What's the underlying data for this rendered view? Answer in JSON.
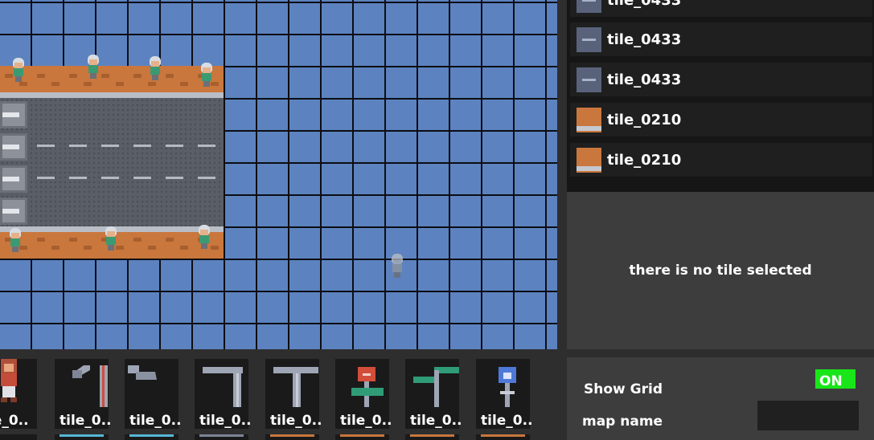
{
  "tile_list": {
    "items": [
      {
        "label": "tile_0433",
        "thumb": "dash-tile"
      },
      {
        "label": "tile_0433",
        "thumb": "dash-tile"
      },
      {
        "label": "tile_0433",
        "thumb": "dash-tile"
      },
      {
        "label": "tile_0210",
        "thumb": "sidewalk-tile"
      },
      {
        "label": "tile_0210",
        "thumb": "sidewalk-tile"
      }
    ]
  },
  "info_panel": {
    "message": "there is no tile selected"
  },
  "palette": {
    "items": [
      {
        "label": "le_0..",
        "icon": "character-icon"
      },
      {
        "label": "tile_0..",
        "icon": "street-lamp-icon"
      },
      {
        "label": "tile_0..",
        "icon": "lamp-head-icon"
      },
      {
        "label": "tile_0..",
        "icon": "pipe-corner-icon"
      },
      {
        "label": "tile_0..",
        "icon": "t-pole-icon"
      },
      {
        "label": "tile_0..",
        "icon": "sign-red-icon"
      },
      {
        "label": "tile_0..",
        "icon": "signpost-icon"
      },
      {
        "label": "tile_0..",
        "icon": "sign-blue-icon"
      }
    ]
  },
  "settings": {
    "show_grid_label": "Show Grid",
    "grid_toggle": "ON",
    "map_name_label": "map name",
    "map_name_value": ""
  },
  "colors": {
    "map_background": "#5c83c0",
    "grid_line": "#0d0d12",
    "toggle_on": "#19e619",
    "panel": "#3d3d3d",
    "list_item": "#1f1f1f"
  }
}
